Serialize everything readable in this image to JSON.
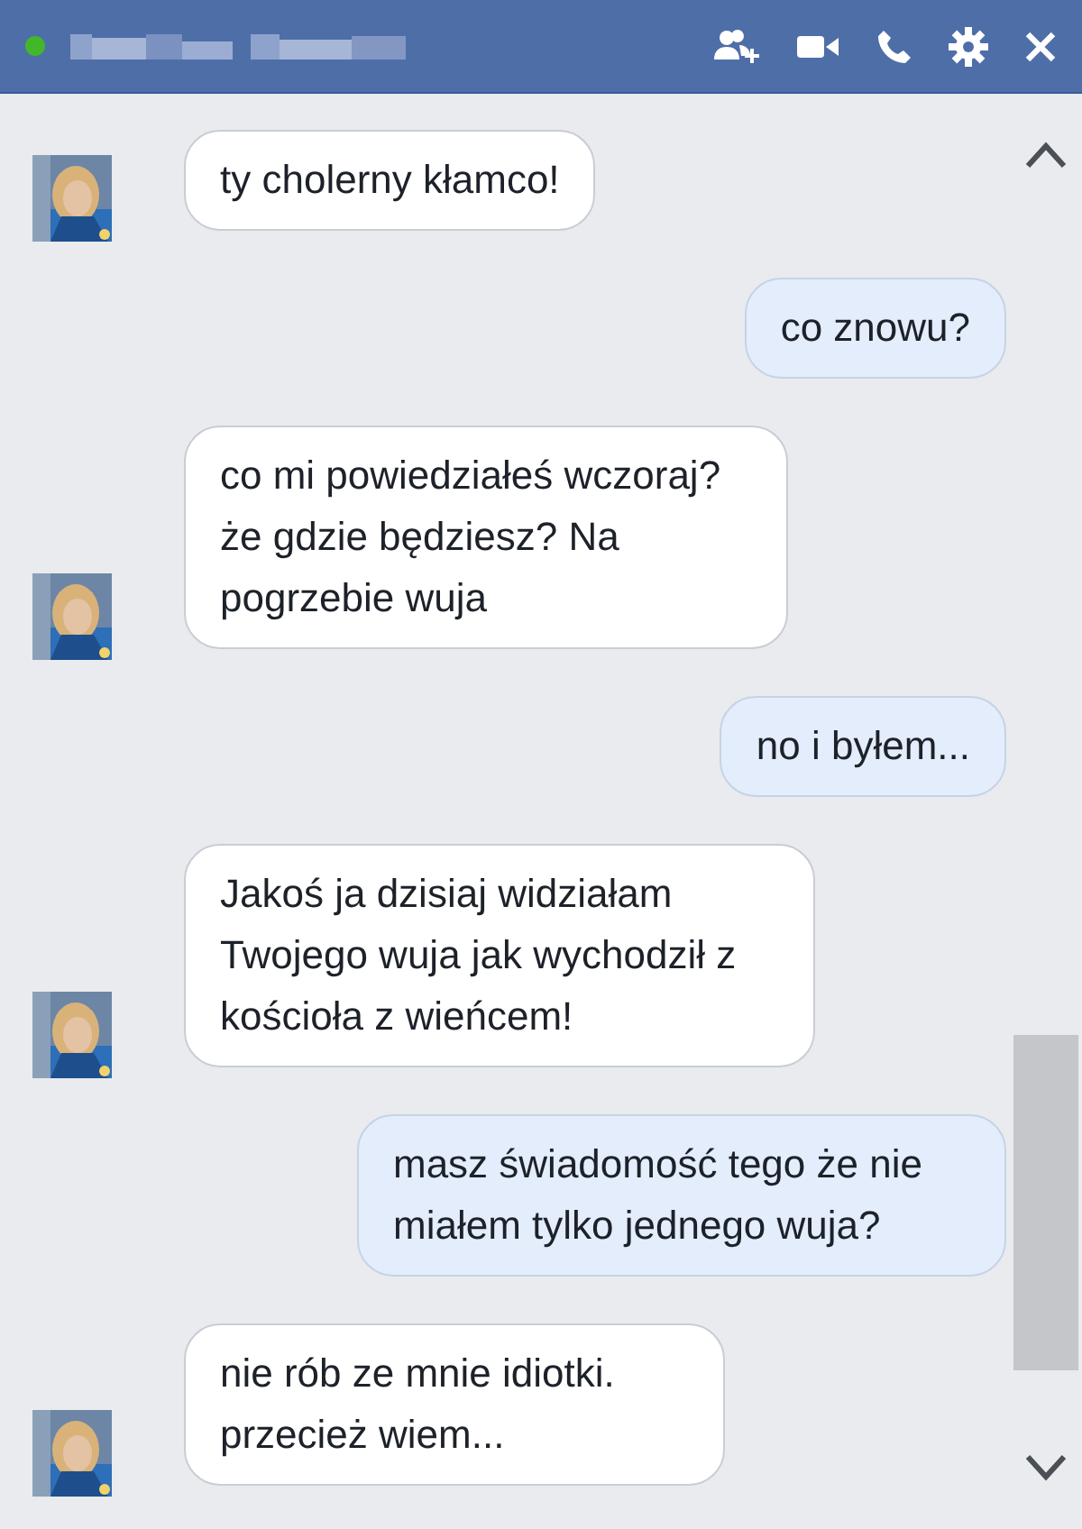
{
  "header": {
    "online": true
  },
  "messages": [
    {
      "kind": "incoming",
      "text": "ty cholerny kłamco!"
    },
    {
      "kind": "outgoing",
      "text": "co znowu?"
    },
    {
      "kind": "incoming",
      "text": "co mi powiedziałeś wczoraj? że gdzie będziesz? Na pogrzebie wuja"
    },
    {
      "kind": "outgoing",
      "text": "no i byłem..."
    },
    {
      "kind": "incoming",
      "text": "Jakoś ja dzisiaj widziałam Twojego wuja jak wychodził z kościoła z wieńcem!"
    },
    {
      "kind": "outgoing",
      "text": "masz świadomość tego że nie miałem tylko jednego wuja?"
    },
    {
      "kind": "incoming",
      "text": "nie rób ze mnie idiotki. przecież wiem..."
    }
  ]
}
